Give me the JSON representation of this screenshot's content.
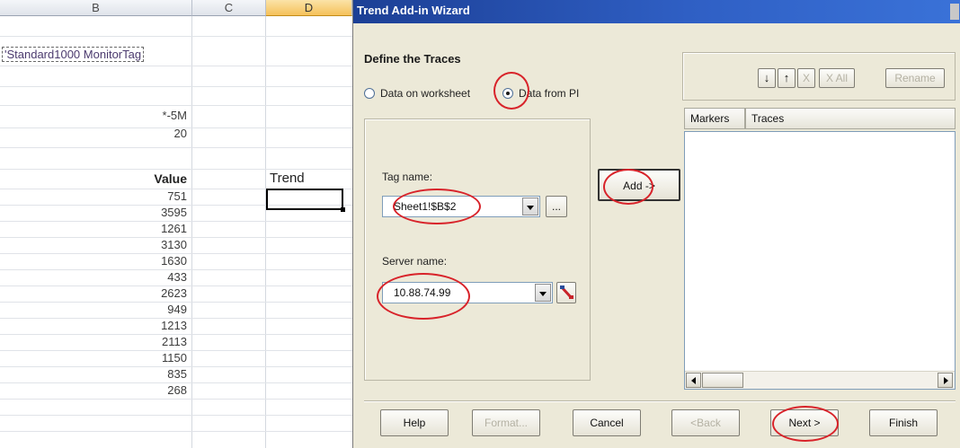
{
  "sheet": {
    "columns": [
      "B",
      "C",
      "D"
    ],
    "tag_cell": "'Standard1000 MonitorTag",
    "start_time": "*-5M",
    "count": "20",
    "value_header": "Value",
    "trend_header": "Trend",
    "values": [
      "751",
      "3595",
      "1261",
      "3130",
      "1630",
      "433",
      "2623",
      "949",
      "1213",
      "2113",
      "1150",
      "835",
      "268"
    ]
  },
  "dialog": {
    "title": "Trend Add-in Wizard",
    "section_title": "Define the Traces",
    "radio_worksheet": "Data on worksheet",
    "radio_pi": "Data from PI",
    "tag_label": "Tag name:",
    "tag_value": "Sheet1!$B$2",
    "browse_label": "...",
    "server_label": "Server name:",
    "server_value": "10.88.74.99",
    "add_label": "Add ->",
    "toolbar": {
      "down_label": "↓",
      "up_label": "↑",
      "remove_label": "X",
      "remove_all_label": "X All",
      "rename_label": "Rename"
    },
    "list_headers": [
      "Markers",
      "Traces"
    ],
    "buttons": {
      "help": "Help",
      "format": "Format...",
      "cancel": "Cancel",
      "back": "<Back",
      "next": "Next >",
      "finish": "Finish"
    }
  },
  "colors": {
    "annotation": "#d8232a",
    "titlebar": "#2f5fc4",
    "dialog_bg": "#ece9d8",
    "selected_column": "#f5c15a"
  }
}
